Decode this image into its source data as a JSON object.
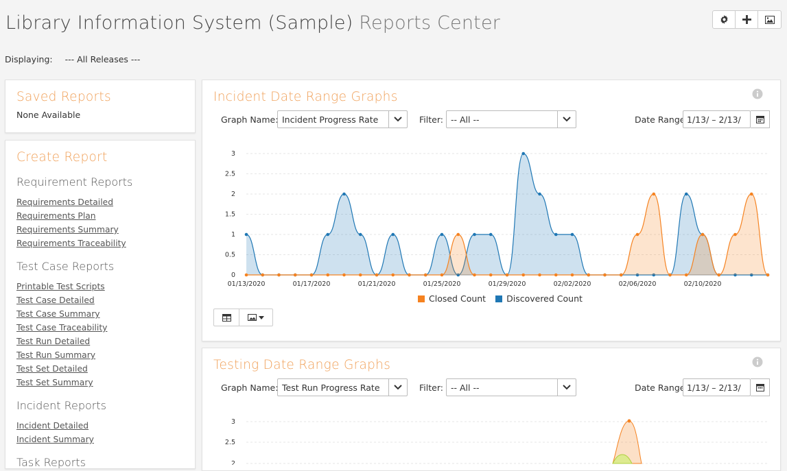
{
  "header": {
    "project": "Library Information System (Sample)",
    "section": "Reports Center"
  },
  "toolbar": {
    "icons": [
      "gear-icon",
      "plus-icon",
      "image-icon"
    ]
  },
  "filter_bar": {
    "label": "Displaying:",
    "value": "--- All Releases ---"
  },
  "saved_reports": {
    "title": "Saved Reports",
    "empty_text": "None Available"
  },
  "create_report": {
    "title": "Create Report",
    "groups": [
      {
        "title": "Requirement Reports",
        "links": [
          "Requirements Detailed",
          "Requirements Plan",
          "Requirements Summary",
          "Requirements Traceability"
        ]
      },
      {
        "title": "Test Case Reports",
        "links": [
          "Printable Test Scripts",
          "Test Case Detailed",
          "Test Case Summary",
          "Test Case Traceability",
          "Test Run Detailed",
          "Test Run Summary",
          "Test Set Detailed",
          "Test Set Summary"
        ]
      },
      {
        "title": "Incident Reports",
        "links": [
          "Incident Detailed",
          "Incident Summary"
        ]
      },
      {
        "title": "Task Reports",
        "links": []
      }
    ]
  },
  "incident_graph": {
    "title": "Incident Date Range Graphs",
    "graph_name_label": "Graph Name:",
    "graph_name_value": "Incident Progress Rate",
    "filter_label": "Filter:",
    "filter_value": "-- All --",
    "date_range_label": "Date Range:",
    "date_range_value": "1/13/ – 2/13/"
  },
  "testing_graph": {
    "title": "Testing Date Range Graphs",
    "graph_name_label": "Graph Name:",
    "graph_name_value": "Test Run Progress Rate",
    "filter_label": "Filter:",
    "filter_value": "-- All --",
    "date_range_label": "Date Range:",
    "date_range_value": "1/13/ – 2/13/"
  },
  "chart_data": [
    {
      "type": "area",
      "title": "",
      "xlabel": "",
      "ylabel": "",
      "ylim": [
        0,
        3
      ],
      "yticks": [
        "0",
        "0.5",
        "1",
        "1.5",
        "2",
        "2.5",
        "3"
      ],
      "x_tick_labels": [
        "01/13/2020",
        "01/17/2020",
        "01/21/2020",
        "01/25/2020",
        "01/29/2020",
        "02/02/2020",
        "02/06/2020",
        "02/10/2020"
      ],
      "x": [
        "01/13/2020",
        "01/14/2020",
        "01/15/2020",
        "01/16/2020",
        "01/17/2020",
        "01/18/2020",
        "01/19/2020",
        "01/20/2020",
        "01/21/2020",
        "01/22/2020",
        "01/23/2020",
        "01/24/2020",
        "01/25/2020",
        "01/26/2020",
        "01/27/2020",
        "01/28/2020",
        "01/29/2020",
        "01/30/2020",
        "01/31/2020",
        "02/01/2020",
        "02/02/2020",
        "02/03/2020",
        "02/04/2020",
        "02/05/2020",
        "02/06/2020",
        "02/07/2020",
        "02/08/2020",
        "02/09/2020",
        "02/10/2020",
        "02/11/2020",
        "02/12/2020",
        "02/13/2020"
      ],
      "legend": "bottom",
      "grid": true,
      "series": [
        {
          "name": "Closed Count",
          "color": "#f58220",
          "values": [
            0,
            0,
            0,
            0,
            0,
            0,
            0,
            0,
            0,
            0,
            0,
            0,
            0,
            1,
            0,
            0,
            0,
            0,
            0,
            0,
            0,
            0,
            0,
            0,
            1,
            2,
            0,
            0,
            1,
            0,
            1,
            2,
            0
          ]
        },
        {
          "name": "Discovered Count",
          "color": "#1f77b4",
          "values": [
            1,
            0,
            0,
            0,
            0,
            1,
            2,
            1,
            0,
            1,
            0,
            0,
            1,
            0,
            1,
            1,
            0,
            3,
            2,
            1,
            1,
            0,
            0,
            0,
            0,
            0,
            0,
            2,
            1,
            0,
            0,
            0,
            0
          ]
        }
      ]
    },
    {
      "type": "area",
      "title": "",
      "ylim": [
        0,
        3
      ],
      "yticks": [
        "2",
        "2.5",
        "3"
      ],
      "note": "partially visible (cropped)"
    }
  ]
}
